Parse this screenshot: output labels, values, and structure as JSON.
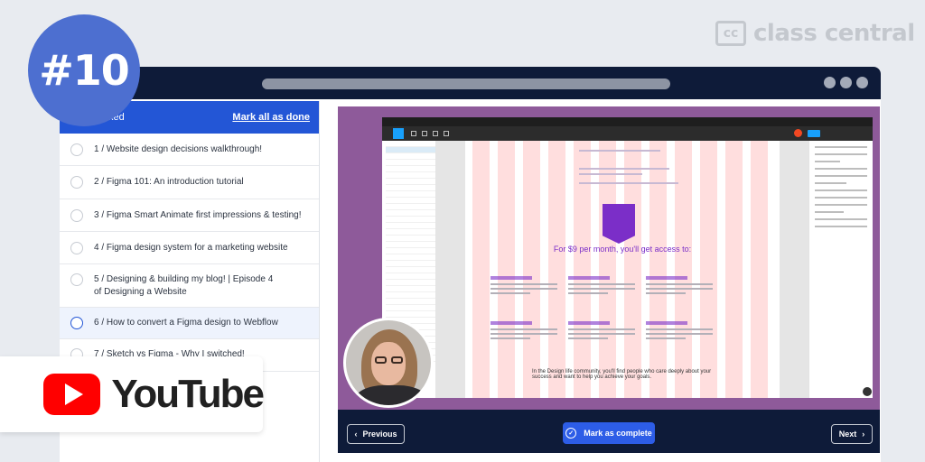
{
  "brand": {
    "logo_mark": "cc",
    "name": "class central"
  },
  "badge": {
    "number": "#10"
  },
  "panel": {
    "header_label": "ked",
    "mark_all_label": "Mark all as done"
  },
  "lessons": [
    {
      "label": "1 / Website design decisions walkthrough!"
    },
    {
      "label": "2 / Figma 101: An introduction tutorial"
    },
    {
      "label": "3 / Figma Smart Animate first impressions & testing!"
    },
    {
      "label": "4 / Figma design system for a marketing website"
    },
    {
      "label": "5 / Designing & building my blog! | Episode 4 of Designing a Website"
    },
    {
      "label": "6 / How to convert a Figma design to Webflow"
    },
    {
      "label": "7 / Sketch vs Figma - Why I switched!"
    }
  ],
  "video": {
    "artboard_title": "For $9 per month, you'll get access to:",
    "artboard_heading": "In the Design life community, you'll find people who care deeply about your success and want to help you achieve your goals."
  },
  "controls": {
    "prev_label": "Previous",
    "complete_label": "Mark as complete",
    "next_label": "Next"
  },
  "youtube": {
    "label": "YouTube"
  },
  "colors": {
    "accent": "#2356d6",
    "dark": "#0e1b39",
    "video_bg": "#8e5a9a",
    "badge": "#4d6fd0",
    "youtube_red": "#ff0000"
  }
}
